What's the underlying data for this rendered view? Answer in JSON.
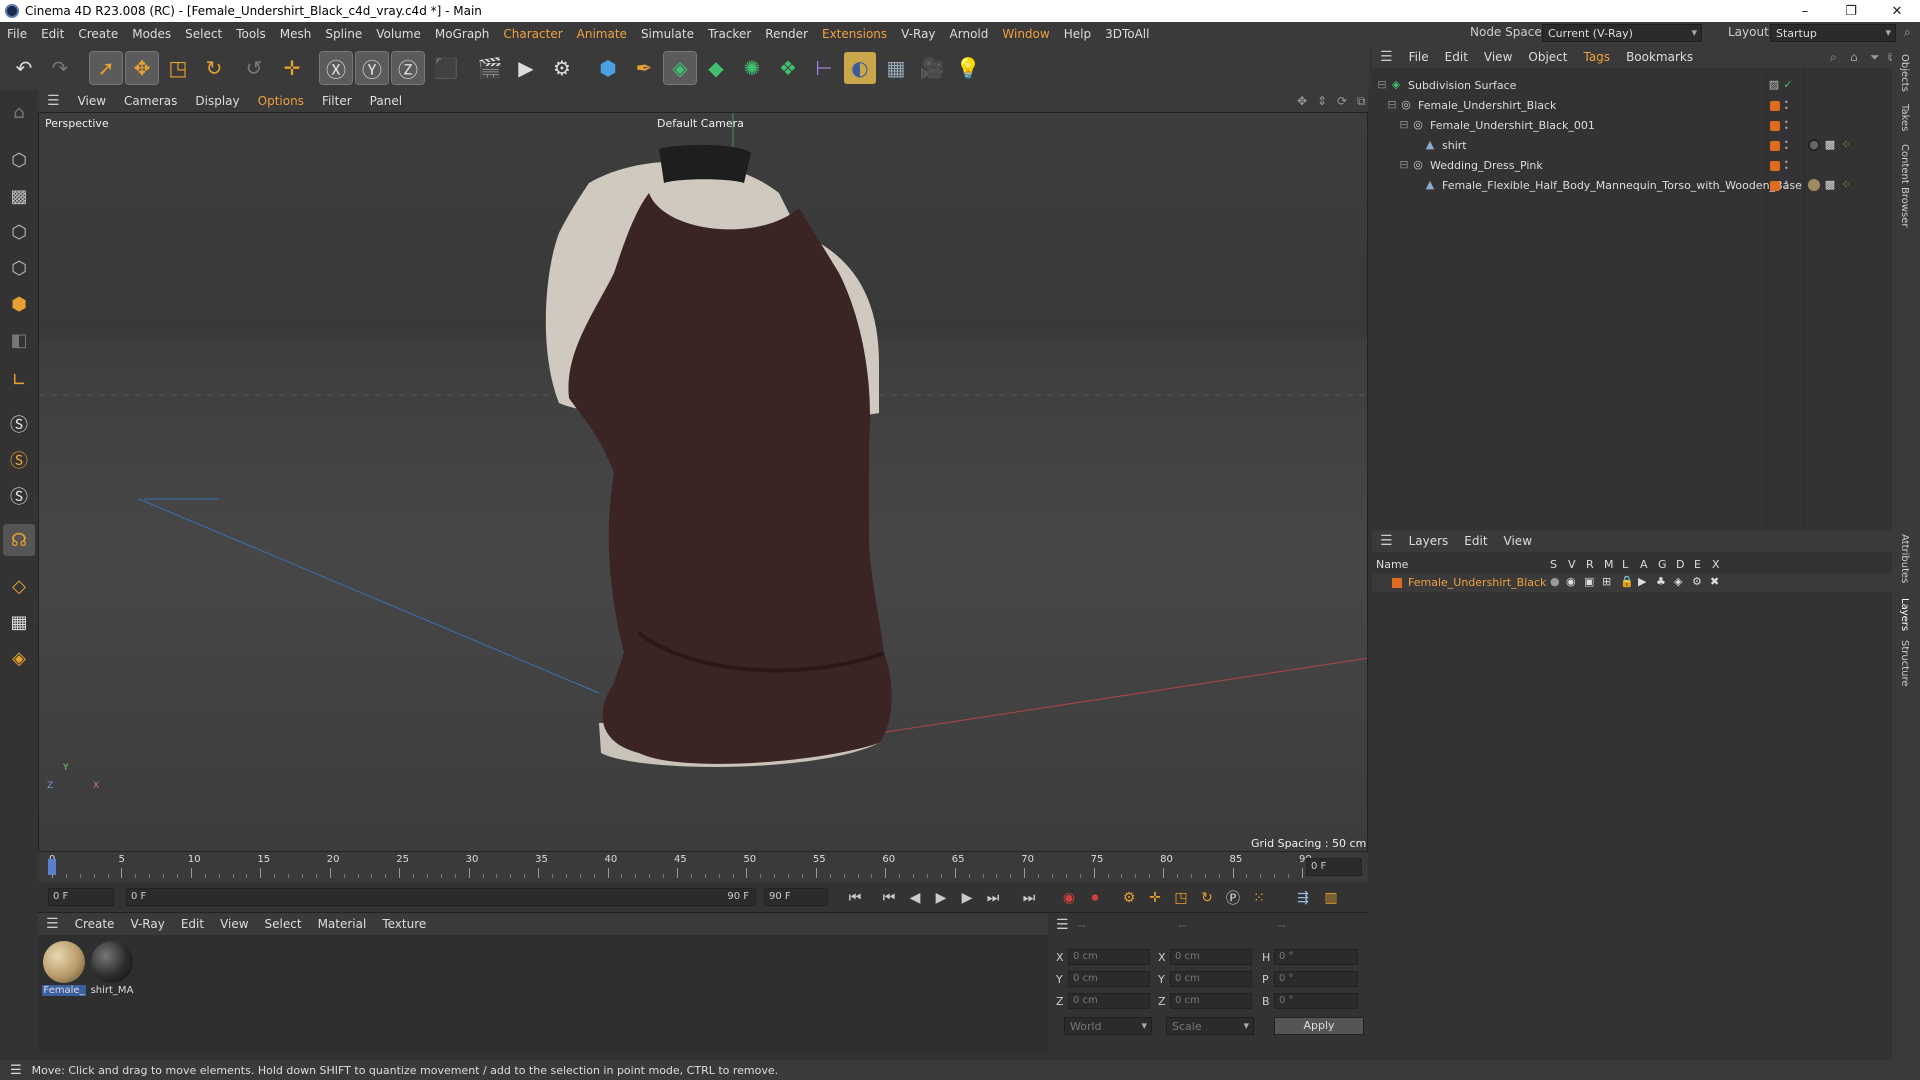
{
  "title": "Cinema 4D R23.008 (RC) - [Female_Undershirt_Black_c4d_vray.c4d *] - Main",
  "window_controls": {
    "min": "–",
    "restore": "❐",
    "close": "✕"
  },
  "menu": [
    "File",
    "Edit",
    "Create",
    "Modes",
    "Select",
    "Tools",
    "Mesh",
    "Spline",
    "Volume",
    "MoGraph",
    "Character",
    "Animate",
    "Simulate",
    "Tracker",
    "Render",
    "Extensions",
    "V-Ray",
    "Arnold",
    "Window",
    "Help",
    "3DToAll"
  ],
  "node_space": {
    "label": "Node Space:",
    "value": "Current (V-Ray)"
  },
  "layout": {
    "label": "Layout:",
    "value": "Startup"
  },
  "viewport": {
    "menu": [
      "View",
      "Cameras",
      "Display",
      "Options",
      "Filter",
      "Panel"
    ],
    "projection": "Perspective",
    "camera": "Default Camera",
    "grid_spacing": "Grid Spacing : 50 cm",
    "axis_labels": {
      "y": "Y",
      "z": "Z",
      "x": "X"
    }
  },
  "timeline": {
    "ticks": [
      "0",
      "5",
      "10",
      "15",
      "20",
      "25",
      "30",
      "35",
      "40",
      "45",
      "50",
      "55",
      "60",
      "65",
      "70",
      "75",
      "80",
      "85",
      "90"
    ],
    "current_frame": "0 F"
  },
  "transport": {
    "start_frame": "0 F",
    "range_start": "0 F",
    "range_end": "90 F",
    "end_frame": "90 F"
  },
  "material_manager": {
    "menu": [
      "Create",
      "V-Ray",
      "Edit",
      "View",
      "Select",
      "Material",
      "Texture"
    ],
    "materials": [
      {
        "name": "Female_",
        "color": "#b89a6a"
      },
      {
        "name": "shirt_MA",
        "color": "#2a2a2a"
      }
    ]
  },
  "coordinates": {
    "headers": [
      "--",
      "--",
      "--"
    ],
    "rows": [
      {
        "a": "X",
        "av": "0 cm",
        "b": "X",
        "bv": "0 cm",
        "c": "H",
        "cv": "0 °"
      },
      {
        "a": "Y",
        "av": "0 cm",
        "b": "Y",
        "bv": "0 cm",
        "c": "P",
        "cv": "0 °"
      },
      {
        "a": "Z",
        "av": "0 cm",
        "b": "Z",
        "bv": "0 cm",
        "c": "B",
        "cv": "0 °"
      }
    ],
    "space": "World",
    "mode": "Scale",
    "apply": "Apply"
  },
  "status": "Move: Click and drag to move elements. Hold down SHIFT to quantize movement / add to the selection in point mode, CTRL to remove.",
  "object_manager": {
    "menu": [
      "File",
      "Edit",
      "View",
      "Object",
      "Tags",
      "Bookmarks"
    ],
    "objects": [
      {
        "name": "Subdivision Surface",
        "indent": 0
      },
      {
        "name": "Female_Undershirt_Black",
        "indent": 1
      },
      {
        "name": "Female_Undershirt_Black_001",
        "indent": 2
      },
      {
        "name": "shirt",
        "indent": 3
      },
      {
        "name": "Wedding_Dress_Pink",
        "indent": 2
      },
      {
        "name": "Female_Flexible_Half_Body_Mannequin_Torso_with_Wooden_Base",
        "indent": 3
      }
    ]
  },
  "layer_manager": {
    "menu": [
      "Layers",
      "Edit",
      "View"
    ],
    "columns": [
      "Name",
      "S",
      "V",
      "R",
      "M",
      "L",
      "A",
      "G",
      "D",
      "E",
      "X"
    ],
    "layers": [
      {
        "name": "Female_Undershirt_Black",
        "color": "#e06a20"
      }
    ]
  },
  "side_tabs": [
    "Objects",
    "Takes",
    "Content Browser",
    "Attributes",
    "Layers",
    "Structure"
  ]
}
